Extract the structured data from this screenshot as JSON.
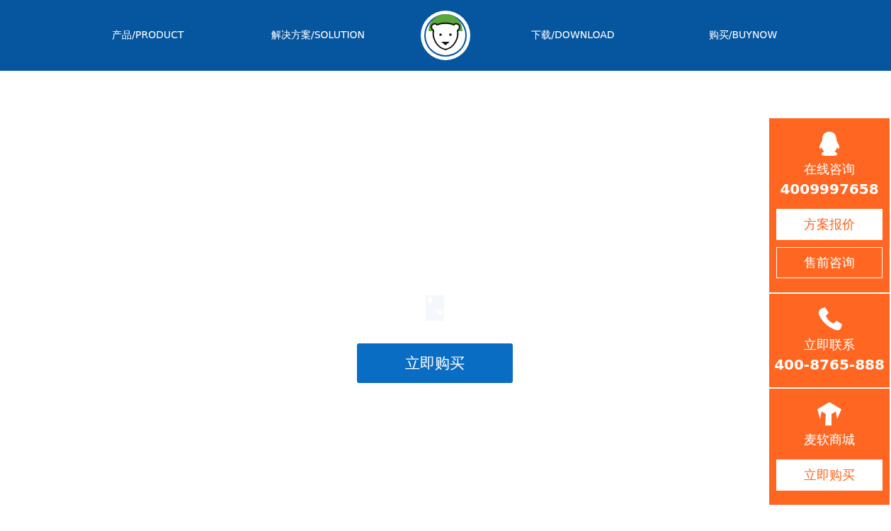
{
  "nav": {
    "left": [
      "产品/PRODUCT",
      "解决方案/SOLUTION"
    ],
    "right": [
      "下载/DOWNLOAD",
      "购买/BUYNOW"
    ]
  },
  "main": {
    "buy_button": "立即购买"
  },
  "sidebar": {
    "sections": [
      {
        "kind": "qq",
        "title": "在线咨询",
        "number": "4009997658",
        "buttons": [
          {
            "label": "方案报价",
            "kind": "solid"
          },
          {
            "label": "售前咨询",
            "kind": "outline"
          }
        ]
      },
      {
        "kind": "phone",
        "title": "立即联系",
        "number": "400-8765-888"
      },
      {
        "kind": "shop",
        "title": "麦软商城",
        "buttons": [
          {
            "label": "立即购买",
            "kind": "solid"
          }
        ]
      }
    ]
  }
}
